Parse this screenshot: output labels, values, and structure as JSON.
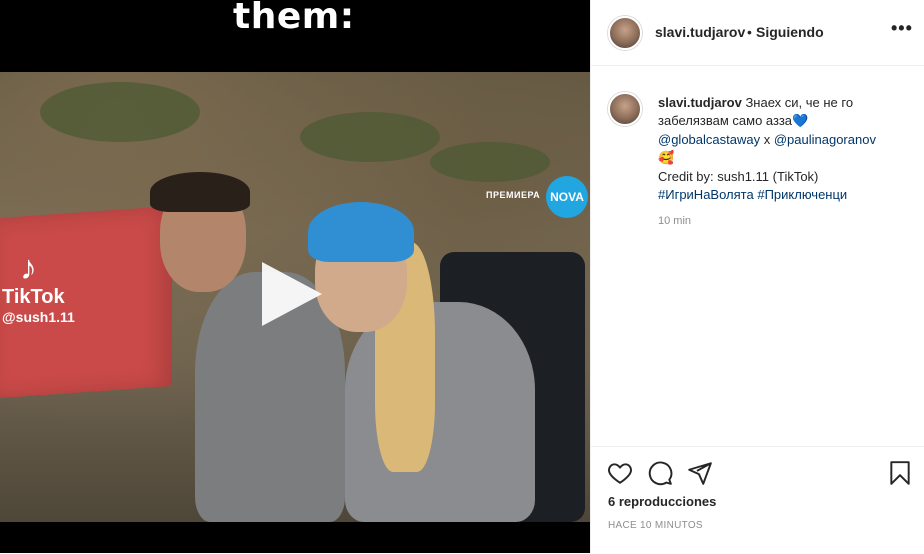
{
  "video": {
    "top_caption": "them:",
    "channel_logo_text": "ПРЕМИЕРА",
    "channel_badge": "NOVA",
    "watermark_brand": "TikTok",
    "watermark_user": "@sush1.11"
  },
  "post_header": {
    "username": "slavi.tudjarov",
    "separator": "•",
    "follow_status": "Siguiendo"
  },
  "caption": {
    "username": "slavi.tudjarov",
    "text": "Знаех си, че не го забелязвам само азза",
    "heart_emoji": "💙",
    "mention1": "@globalcastaway",
    "connector": "x",
    "mention2": "@paulinagoranov",
    "smile_emoji": "🥰",
    "credit": "Credit by: sush1.11 (TikTok)",
    "hashtag1": "#ИгриНаВолята",
    "hashtag2": "#Приключенци",
    "time": "10 min"
  },
  "stats": {
    "views": "6 reproducciones",
    "ago": "HACE 10 MINUTOS"
  },
  "icons": {
    "more": "more-options-icon",
    "like": "heart-icon",
    "comment": "comment-icon",
    "share": "share-icon",
    "save": "bookmark-icon",
    "play": "play-icon"
  }
}
